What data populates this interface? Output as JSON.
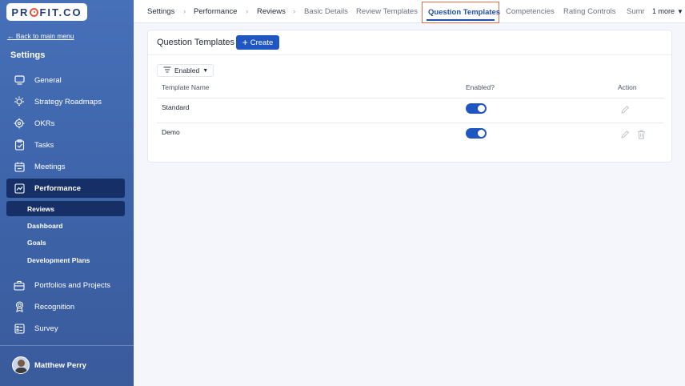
{
  "brand": {
    "logo_text_pre": "PR",
    "logo_text_post": "FIT.CO",
    "accent": "#e5533b",
    "primary": "#1f56c2"
  },
  "sidebar": {
    "back_link": "← Back to main menu",
    "title": "Settings",
    "items": [
      {
        "label": "General",
        "icon": "monitor-icon"
      },
      {
        "label": "Strategy Roadmaps",
        "icon": "bulb-icon"
      },
      {
        "label": "OKRs",
        "icon": "target-icon"
      },
      {
        "label": "Tasks",
        "icon": "clipboard-check-icon"
      },
      {
        "label": "Meetings",
        "icon": "calendar-icon"
      },
      {
        "label": "Performance",
        "icon": "chart-line-icon",
        "active": true
      }
    ],
    "sub_items": [
      {
        "label": "Reviews",
        "active": true
      },
      {
        "label": "Dashboard"
      },
      {
        "label": "Goals"
      },
      {
        "label": "Development Plans"
      }
    ],
    "items_after": [
      {
        "label": "Portfolios and Projects",
        "icon": "briefcase-icon"
      },
      {
        "label": "Recognition",
        "icon": "award-icon"
      },
      {
        "label": "Survey",
        "icon": "survey-icon"
      }
    ],
    "user": {
      "name": "Matthew Perry"
    }
  },
  "topbar": {
    "crumbs": [
      "Settings",
      "Performance",
      "Reviews"
    ],
    "tabs": [
      "Basic Details",
      "Review Templates",
      "Question Templates",
      "Competencies",
      "Rating Controls",
      "Sumr"
    ],
    "active_tab": "Question Templates",
    "more_label": "1 more"
  },
  "card": {
    "title": "Question Templates",
    "create_label": "Create",
    "filter_label": "Enabled",
    "columns": [
      "Template Name",
      "Enabled?",
      "Action"
    ],
    "rows": [
      {
        "name": "Standard",
        "enabled": true,
        "deletable": false
      },
      {
        "name": "Demo",
        "enabled": true,
        "deletable": true
      }
    ]
  }
}
